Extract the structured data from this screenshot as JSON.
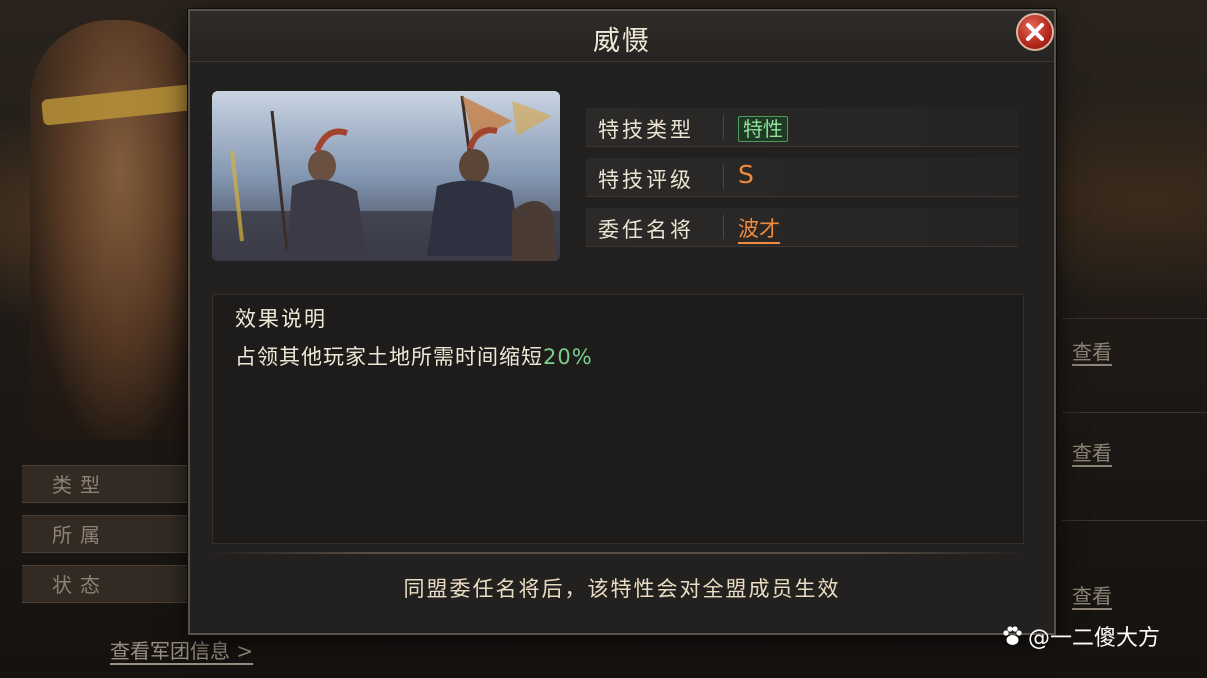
{
  "background": {
    "rows": [
      "类型",
      "所属",
      "状态"
    ],
    "view_links": [
      "查看",
      "查看",
      "查看"
    ],
    "team_link": "查看军团信息 >"
  },
  "modal": {
    "title": "威慑",
    "info": [
      {
        "label": "特技类型",
        "value": "特性"
      },
      {
        "label": "特技评级",
        "value": "S"
      },
      {
        "label": "委任名将",
        "value": "波才"
      }
    ],
    "effect": {
      "title": "效果说明",
      "text_prefix": "占领其他玩家土地所需时间缩短",
      "percent": "20%"
    },
    "footer_note": "同盟委任名将后，该特性会对全盟成员生效"
  },
  "watermark": "@一二傻大方",
  "colors": {
    "grade": "#f08a3c",
    "trait_tag": "#8fe09a",
    "percent": "#79d08a",
    "close_button": "#b3261c"
  }
}
